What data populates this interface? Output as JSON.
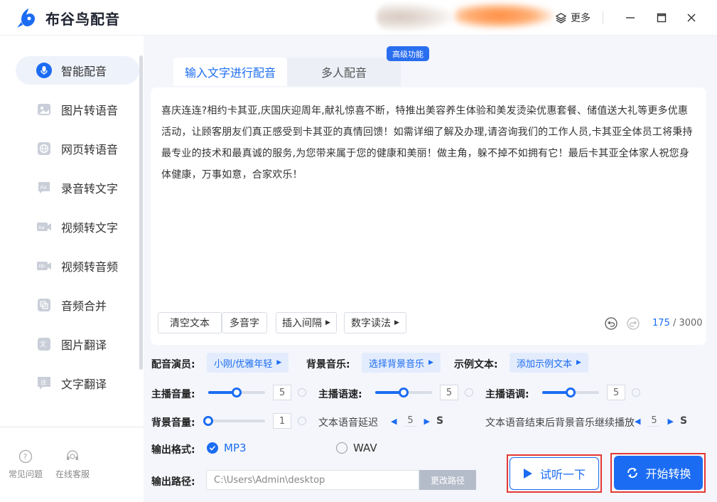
{
  "app": {
    "title": "布谷鸟配音",
    "more_label": "更多",
    "brand_color": "#1b6cf2"
  },
  "window_controls": [
    "minimize-icon",
    "maximize-icon",
    "close-icon"
  ],
  "sidebar": {
    "items": [
      {
        "label": "智能配音",
        "icon": "mic-icon",
        "active": true
      },
      {
        "label": "图片转语音",
        "icon": "image-icon"
      },
      {
        "label": "网页转语音",
        "icon": "globe-icon"
      },
      {
        "label": "录音转文字",
        "icon": "text-bubble-icon"
      },
      {
        "label": "视频转文字",
        "icon": "video-text-icon"
      },
      {
        "label": "视频转音频",
        "icon": "video-audio-icon"
      },
      {
        "label": "音频合并",
        "icon": "merge-icon"
      },
      {
        "label": "图片翻译",
        "icon": "translate-image-icon"
      },
      {
        "label": "文字翻译",
        "icon": "translate-text-icon"
      }
    ],
    "footer": {
      "faq": "常见问题",
      "service": "在线客服"
    }
  },
  "tabs": {
    "active": "输入文字进行配音",
    "inactive": "多人配音",
    "badge": "高级功能"
  },
  "editor": {
    "text": "喜庆连连?相约卡其亚,庆国庆迎周年,献礼惊喜不断，特推出美容养生体验和美发烫染优惠套餐、储值送大礼等更多优惠活动，让顾客朋友们真正感受到卡其亚的真情回馈！如需详细了解及办理,请咨询我们的工作人员,卡其亚全体员工将秉持最专业的技术和最真诚的服务,为您带来属于您的健康和美丽！做主角，躲不掉不如拥有它！最后卡其亚全体家人祝您身体健康，万事如意，合家欢乐！",
    "buttons": {
      "clear": "清空文本",
      "polyphone": "多音字",
      "insert_pause": "插入间隔",
      "number_reading": "数字读法"
    },
    "count_current": "175",
    "count_separator": " / ",
    "count_max": "3000"
  },
  "settings": {
    "voice_label": "配音演员:",
    "voice_value": "小刚/优雅年轻",
    "bgm_label": "背景音乐:",
    "bgm_value": "选择背景音乐",
    "sample_label": "示例文本:",
    "sample_value": "添加示例文本",
    "volume_label": "主播音量:",
    "volume_value": "5",
    "volume_level": 0.5,
    "speed_label": "主播语速:",
    "speed_value": "5",
    "speed_level": 0.5,
    "pitch_label": "主播语调:",
    "pitch_value": "5",
    "pitch_level": 0.5,
    "bg_volume_label": "背景音量:",
    "bg_volume_value": "1",
    "bg_volume_level": 0.0,
    "delay_label": "文本语音延迟",
    "delay_value": "5",
    "delay_unit": "S",
    "bgm_after_label": "文本语音结束后背景音乐继续播放",
    "bgm_after_value": "5",
    "bgm_after_unit": "S",
    "format_label": "输出格式:",
    "format_options": [
      "MP3",
      "WAV"
    ],
    "format_selected": "MP3",
    "path_label": "输出路径:",
    "path_value": "C:\\Users\\Admin\\desktop",
    "path_button": "更改路径"
  },
  "actions": {
    "try_listen": "试听一下",
    "start_convert": "开始转换"
  }
}
